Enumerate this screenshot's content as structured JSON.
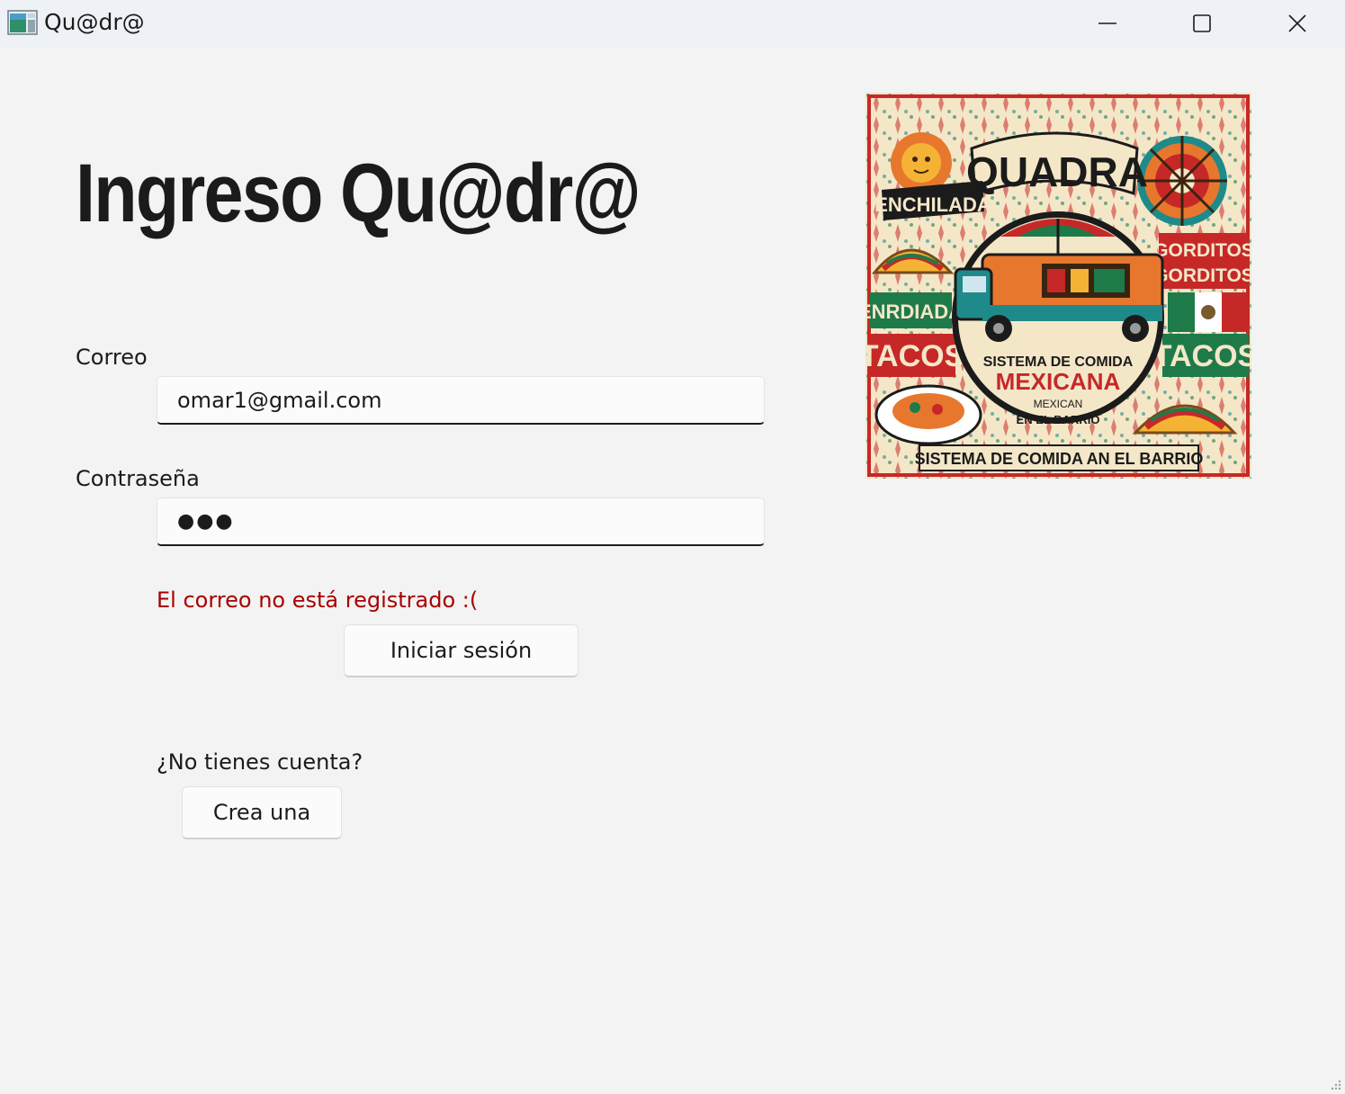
{
  "window": {
    "title": "Qu@dr@",
    "icons": {
      "app": "app-window-icon",
      "minimize": "minimize-icon",
      "maximize": "maximize-icon",
      "close": "close-icon"
    }
  },
  "login": {
    "heading": "Ingreso Qu@dr@",
    "email_label": "Correo",
    "email_value": "omar1@gmail.com",
    "password_label": "Contraseña",
    "password_masked": "●●●",
    "error_message": "El correo no está registrado :(",
    "submit_label": "Iniciar sesión",
    "signup_question": "¿No tienes cuenta?",
    "signup_button": "Crea una"
  },
  "poster": {
    "top_banner": "QUADRA",
    "word_enchilada": "ENCHILADA",
    "word_gorditos_1": "GORDITOS",
    "word_gorditos_2": "GORDITOS",
    "word_enrdiada": "ENRDIADA",
    "word_tacos_left": "TACOS",
    "word_tacos_right": "TACOS",
    "circle_line_1": "SISTEMA DE COMIDA",
    "circle_line_2": "MEXICANA",
    "circle_line_3": "MEXICAN",
    "circle_line_4": "EN EL BARRIO",
    "bottom_banner": "SISTEMA DE COMIDA AN EL BARRIO"
  },
  "colors": {
    "background": "#f3f3f3",
    "titlebar": "#eef1f6",
    "error": "#a80000",
    "poster_red": "#c62828",
    "poster_green": "#1f7a4a",
    "poster_orange": "#e8772e",
    "poster_teal": "#1f8a8a",
    "poster_cream": "#f4e7c8"
  }
}
